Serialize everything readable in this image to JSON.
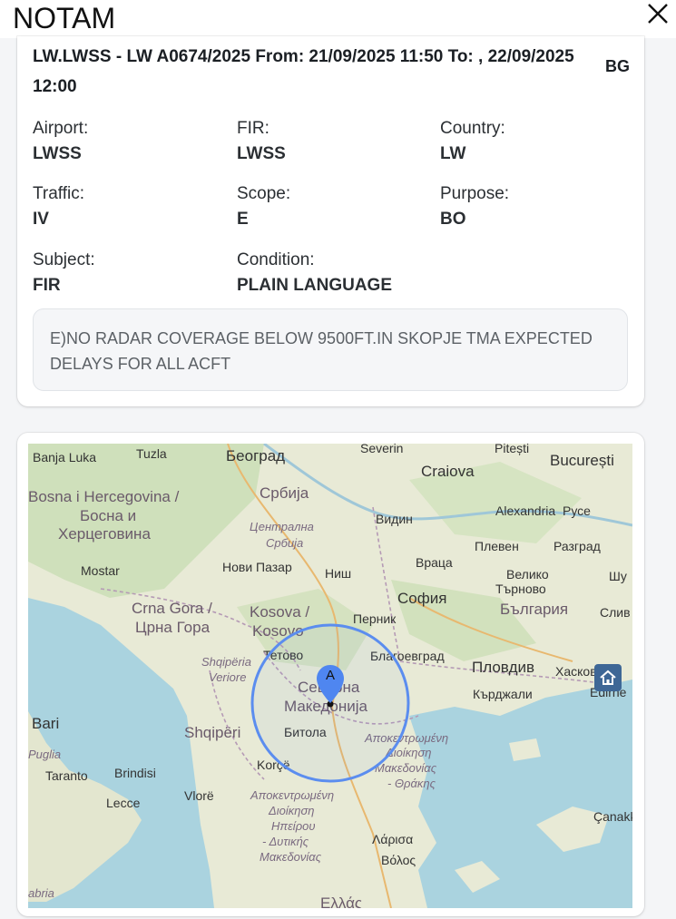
{
  "dialog": {
    "title": "NOTAM",
    "close_icon": "close-icon"
  },
  "notam": {
    "headline": "LW.LWSS - LW A0674/2025 From: 21/09/2025 11:50 To: , 22/09/2025 12:00",
    "headline_tag": "BG",
    "fields": [
      {
        "label": "Airport:",
        "value": "LWSS"
      },
      {
        "label": "FIR:",
        "value": "LWSS"
      },
      {
        "label": "Country:",
        "value": "LW"
      },
      {
        "label": "Traffic:",
        "value": "IV"
      },
      {
        "label": "Scope:",
        "value": "E"
      },
      {
        "label": "Purpose:",
        "value": "BO"
      },
      {
        "label": "Subject:",
        "value": "FIR"
      },
      {
        "label": "Condition:",
        "value": "PLAIN LANGUAGE"
      }
    ],
    "remark": "E)NO RADAR COVERAGE BELOW 9500FT.IN SKOPJE TMA EXPECTED DELAYS FOR ALL ACFT"
  },
  "map": {
    "marker_label": "A",
    "home_icon": "home-icon",
    "colors": {
      "sea": "#aad3df",
      "land": "#e8ead6",
      "circle": "#5b8def",
      "marker": "#4f86f0",
      "home": "#3e6796"
    },
    "labels": {
      "banja_luka": "Banja Luka",
      "tuzla": "Tuzla",
      "beograd": "Београд",
      "severin": "Severin",
      "pitesti": "Pitești",
      "bucuresti": "București",
      "craiova": "Craiova",
      "bosna1": "Bosna i Hercegovina /",
      "bosna2": "Босна и",
      "bosna3": "Херцеговина",
      "srbija": "Србија",
      "centralna1": "Централна",
      "centralna2": "Србија",
      "vidin": "Видин",
      "alexandria": "Alexandria",
      "ruse": "Русе",
      "mostar": "Mostar",
      "novi_pazar": "Нови Пазар",
      "nis": "Ниш",
      "vraca": "Враца",
      "pleven": "Плевен",
      "razgrad": "Разград",
      "veliko1": "Велико",
      "veliko2": "Търново",
      "shu": "Шу",
      "crna1": "Crna Gora /",
      "crna2": "Црна Гора",
      "kosova1": "Kosova /",
      "kosova2": "Kosovo",
      "sofia": "София",
      "pernik": "Перник",
      "balgariya": "България",
      "sliven": "Слив",
      "shqiperia1": "Shqipëria",
      "shqiperia2": "Veriore",
      "tetovo": "Тетово",
      "blagoevgrad": "Благоевград",
      "plovdiv": "Пловдив",
      "haskovo": "Хасково",
      "severna": "Северна",
      "makedonija": "Македонија",
      "kardzhali": "Кърджали",
      "edirne": "Edirne",
      "bari": "Bari",
      "shqiperi": "Shqipëri",
      "bitola": "Битола",
      "apok1": "Αποκεντρωμένη",
      "apok2": "Διοίκηση",
      "apok3": "Μακεδονίας",
      "apok4": "- Θράκης",
      "puglia": "Puglia",
      "taranto": "Taranto",
      "brindisi": "Brindisi",
      "korce": "Korçë",
      "lecce": "Lecce",
      "vlore": "Vlorë",
      "apok5": "Αποκεντρωμένη",
      "apok6": "Διοίκηση",
      "apok7": "Ηπείρου",
      "apok8": "- Δυτικής",
      "apok9": "Μακεδονίας",
      "larisa": "Λάρισα",
      "volos": "Βόλος",
      "canakk": "Çanakk",
      "abria": "abria",
      "ellas": "Ελλάς"
    }
  }
}
